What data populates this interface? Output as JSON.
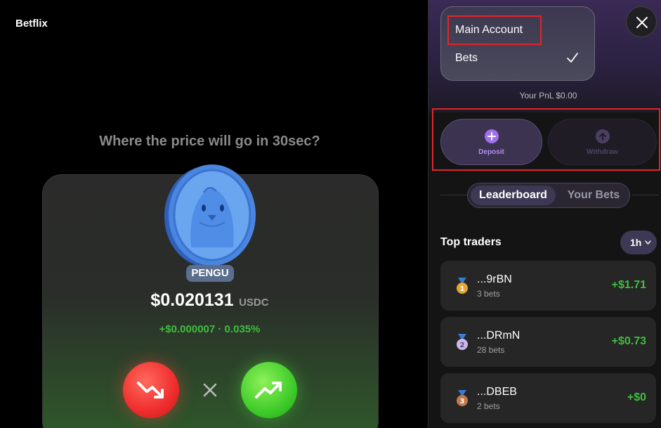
{
  "app": {
    "brand": "Betflix"
  },
  "game": {
    "question": "Where the price will go in 30sec?",
    "token": "PENGU",
    "price": "$0.020131",
    "unit": "USDC",
    "change": "+$0.000007 · 0.035%",
    "icons": {
      "down": "trend-down-icon",
      "up": "trend-up-icon",
      "separator": "x-icon"
    },
    "colors": {
      "down": "#ef2d2d",
      "up": "#3fcc2a",
      "change": "#3fbf3f"
    }
  },
  "panel": {
    "account_menu": {
      "items": [
        {
          "label": "Main Account",
          "selected": false
        },
        {
          "label": "Bets",
          "selected": true
        }
      ]
    },
    "pnl": "Your PnL $0.00",
    "actions": {
      "deposit": {
        "label": "Deposit",
        "icon": "plus-circle-icon"
      },
      "withdraw": {
        "label": "Withdraw",
        "icon": "arrow-up-circle-icon"
      }
    },
    "tabs": [
      {
        "label": "Leaderboard",
        "active": true
      },
      {
        "label": "Your Bets",
        "active": false
      }
    ],
    "section_title": "Top traders",
    "period": "1h",
    "traders": [
      {
        "rank": 1,
        "name": "...9rBN",
        "bets": "3 bets",
        "pnl": "+$1.71",
        "medal": "gold-medal-icon"
      },
      {
        "rank": 2,
        "name": "...DRmN",
        "bets": "28 bets",
        "pnl": "+$0.73",
        "medal": "silver-medal-icon"
      },
      {
        "rank": 3,
        "name": "...DBEB",
        "bets": "2 bets",
        "pnl": "+$0",
        "medal": "bronze-medal-icon"
      }
    ]
  }
}
